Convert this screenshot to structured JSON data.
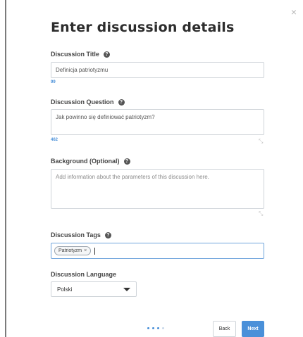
{
  "dialog": {
    "title": "Enter discussion details",
    "close_label": "×"
  },
  "fields": {
    "title_label": "Discussion Title",
    "title_value": "Definicja patriotyzmu",
    "title_counter": "99",
    "question_label": "Discussion Question",
    "question_value": "Jak powinno się definiować patriotyzm?",
    "question_counter": "462",
    "background_label": "Background (Optional)",
    "background_placeholder": "Add information about the parameters of this discussion here.",
    "tags_label": "Discussion Tags",
    "tags": [
      {
        "label": "Patriotyzm",
        "remove": "×"
      }
    ],
    "language_label": "Discussion Language",
    "language_value": "Polski"
  },
  "help_glyph": "?",
  "footer": {
    "back_label": "Back",
    "next_label": "Next"
  },
  "colors": {
    "accent": "#4a90d9",
    "border": "#cfd4d9",
    "focus_border": "#6fa4dc"
  }
}
